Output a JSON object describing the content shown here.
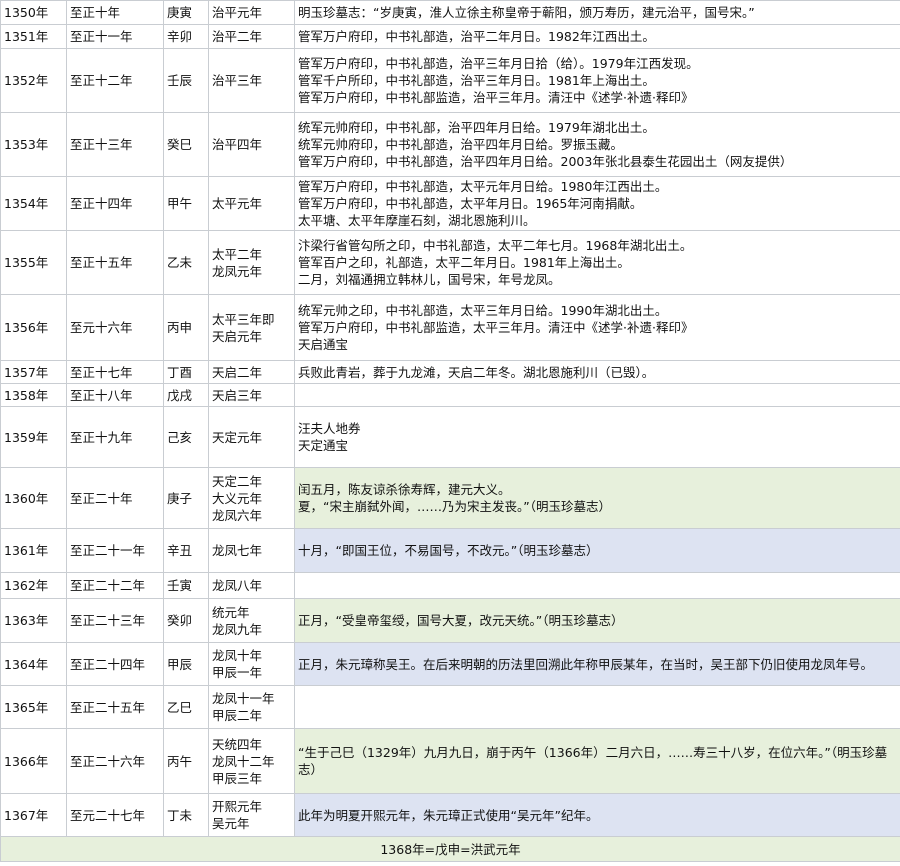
{
  "rows": [
    {
      "year": "1350年",
      "era": "至正十年",
      "ganzhi": "庚寅",
      "reign": [
        "治平元年"
      ],
      "notes": [
        "明玉珍墓志：“岁庚寅，淮人立徐主称皇帝于蕲阳，颁万寿历，建元治平，国号宋。”"
      ],
      "bg": "",
      "h": 24
    },
    {
      "year": "1351年",
      "era": "至正十一年",
      "ganzhi": "辛卯",
      "reign": [
        "治平二年"
      ],
      "notes": [
        "管军万户府印，中书礼部造，治平二年月日。1982年江西出土。"
      ],
      "bg": "",
      "h": 24
    },
    {
      "year": "1352年",
      "era": "至正十二年",
      "ganzhi": "壬辰",
      "reign": [
        "治平三年"
      ],
      "notes": [
        "管军万户府印，中书礼部造，治平三年月日拾（给）。1979年江西发现。",
        "管军千户所印，中书礼部造，治平三年月日。1981年上海出土。",
        "管军万户府印，中书礼部监造，治平三年月。清汪中《述学·补遗·释印》"
      ],
      "bg": "",
      "h": 64
    },
    {
      "year": "1353年",
      "era": "至正十三年",
      "ganzhi": "癸巳",
      "reign": [
        "治平四年"
      ],
      "notes": [
        "统军元帅府印，中书礼部，治平四年月日给。1979年湖北出土。",
        "统军元帅府印，中书礼部造，治平四年月日给。罗振玉藏。",
        "管军万户府印，中书礼部造，治平四年月日给。2003年张北县泰生花园出土（网友提供）"
      ],
      "bg": "",
      "h": 64
    },
    {
      "year": "1354年",
      "era": "至正十四年",
      "ganzhi": "甲午",
      "reign": [
        "太平元年"
      ],
      "notes": [
        "管军万户府印，中书礼部造，太平元年月日给。1980年江西出土。",
        "管军万户府印，中书礼部造，太平年月日。1965年河南捐献。",
        "太平塘、太平年摩崖石刻，湖北恩施利川。"
      ],
      "bg": "",
      "h": 54
    },
    {
      "year": "1355年",
      "era": "至正十五年",
      "ganzhi": "乙未",
      "reign": [
        "太平二年",
        "龙凤元年"
      ],
      "notes": [
        "汴梁行省管勾所之印，中书礼部造，太平二年七月。1968年湖北出土。",
        "管军百户之印，礼部造，太平二年月日。1981年上海出土。",
        "二月，刘福通拥立韩林儿，国号宋，年号龙凤。"
      ],
      "bg": "",
      "h": 64
    },
    {
      "year": "1356年",
      "era": "至元十六年",
      "ganzhi": "丙申",
      "reign": [
        "太平三年即",
        "天启元年"
      ],
      "notes": [
        "统军元帅之印，中书礼部造，太平三年月日给。1990年湖北出土。",
        "管军万户府印，中书礼部监造，太平三年月。清汪中《述学·补遗·释印》",
        "天启通宝"
      ],
      "bg": "",
      "h": 66
    },
    {
      "year": "1357年",
      "era": "至正十七年",
      "ganzhi": "丁酉",
      "reign": [
        "天启二年"
      ],
      "notes": [
        "兵败此青岩，葬于九龙滩，天启二年冬。湖北恩施利川（已毁）。"
      ],
      "bg": "",
      "h": 23
    },
    {
      "year": "1358年",
      "era": "至正十八年",
      "ganzhi": "戊戌",
      "reign": [
        "天启三年"
      ],
      "notes": [
        ""
      ],
      "bg": "",
      "h": 23
    },
    {
      "year": "1359年",
      "era": "至正十九年",
      "ganzhi": "己亥",
      "reign": [
        "天定元年"
      ],
      "notes": [
        "汪夫人地券",
        "天定通宝"
      ],
      "bg": "",
      "h": 61
    },
    {
      "year": "1360年",
      "era": "至正二十年",
      "ganzhi": "庚子",
      "reign": [
        "天定二年",
        "大义元年",
        "龙凤六年"
      ],
      "notes": [
        "闰五月，陈友谅杀徐寿辉，建元大义。",
        "夏，“宋主崩弑外闻，……乃为宋主发丧。”（明玉珍墓志）"
      ],
      "bg": "green",
      "h": 61
    },
    {
      "year": "1361年",
      "era": "至正二十一年",
      "ganzhi": "辛丑",
      "reign": [
        "龙凤七年"
      ],
      "notes": [
        "十月，“即国王位，不易国号，不改元。”（明玉珍墓志）"
      ],
      "bg": "blue",
      "h": 44
    },
    {
      "year": "1362年",
      "era": "至正二十二年",
      "ganzhi": "壬寅",
      "reign": [
        "龙凤八年"
      ],
      "notes": [
        ""
      ],
      "bg": "",
      "h": 26
    },
    {
      "year": "1363年",
      "era": "至正二十三年",
      "ganzhi": "癸卯",
      "reign": [
        "统元年",
        "龙凤九年"
      ],
      "notes": [
        "正月，“受皇帝玺绶，国号大夏，改元天统。”（明玉珍墓志）"
      ],
      "bg": "green",
      "h": 44
    },
    {
      "year": "1364年",
      "era": "至正二十四年",
      "ganzhi": "甲辰",
      "reign": [
        "龙凤十年",
        "甲辰一年"
      ],
      "notes": [
        "正月，朱元璋称吴王。在后来明朝的历法里回溯此年称甲辰某年，在当时，吴王部下仍旧使用龙凤年号。"
      ],
      "bg": "blue",
      "h": 43
    },
    {
      "year": "1365年",
      "era": "至正二十五年",
      "ganzhi": "乙巳",
      "reign": [
        "龙凤十一年",
        "甲辰二年"
      ],
      "notes": [
        ""
      ],
      "bg": "",
      "h": 43
    },
    {
      "year": "1366年",
      "era": "至正二十六年",
      "ganzhi": "丙午",
      "reign": [
        "天统四年",
        "龙凤十二年",
        "甲辰三年"
      ],
      "notes": [
        "“生于己巳（1329年）九月九日，崩于丙午（1366年）二月六日，……寿三十八岁，在位六年。”（明玉珍墓志）"
      ],
      "bg": "green",
      "h": 65
    },
    {
      "year": "1367年",
      "era": "至元二十七年",
      "ganzhi": "丁未",
      "reign": [
        "开熙元年",
        "吴元年"
      ],
      "notes": [
        "此年为明夏开熙元年，朱元璋正式使用“吴元年”纪年。"
      ],
      "bg": "blue",
      "h": 43
    }
  ],
  "footer": "1368年=戊申=洪武元年"
}
